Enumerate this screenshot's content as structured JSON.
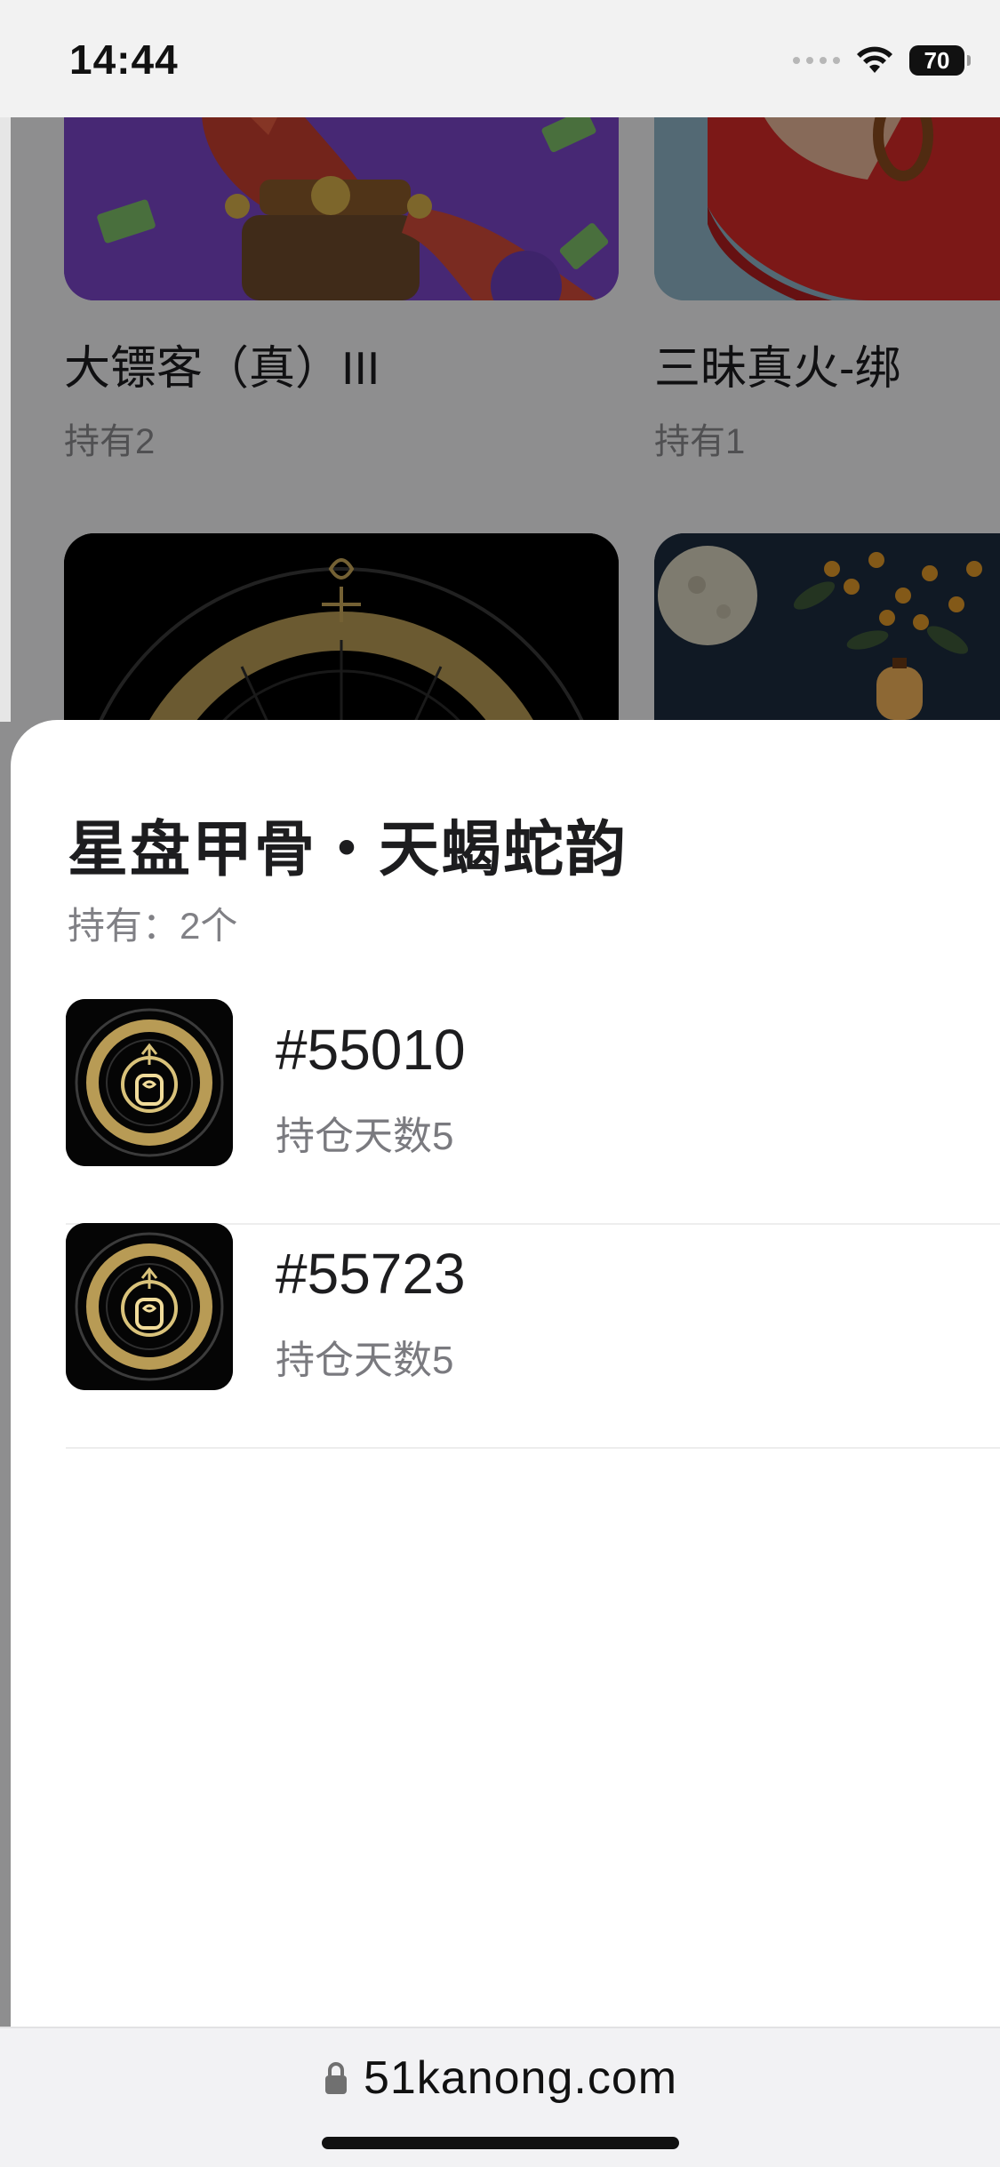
{
  "status_bar": {
    "time": "14:44",
    "battery": "70",
    "icons": [
      "signal-dots-icon",
      "wifi-icon",
      "battery-icon"
    ]
  },
  "grid": {
    "cards": [
      {
        "title": "大镖客（真）III",
        "subtitle": "持有2",
        "image": "cowboy-dragon-character"
      },
      {
        "title": "三昧真火-绑",
        "subtitle": "持有1",
        "image": "red-dress-character"
      },
      {
        "title": "",
        "subtitle": "",
        "image": "zodiac-wheel-scorpio"
      },
      {
        "title": "",
        "subtitle": "",
        "image": "moon-osmanthus-lantern"
      }
    ]
  },
  "sheet": {
    "title": "星盘甲骨・天蝎蛇韵",
    "count": "持有：2个",
    "items": [
      {
        "id": "#55010",
        "days": "持仓天数5",
        "image": "zodiac-snake-thumbnail"
      },
      {
        "id": "#55723",
        "days": "持仓天数5",
        "image": "zodiac-snake-thumbnail"
      }
    ]
  },
  "url_bar": {
    "url": "51kanong.com",
    "icon": "lock-icon"
  },
  "colors": {
    "accent_gold": "#c9a85a",
    "sheet_bg": "#ffffff",
    "overlay": "rgba(0,0,0,0.42)"
  }
}
